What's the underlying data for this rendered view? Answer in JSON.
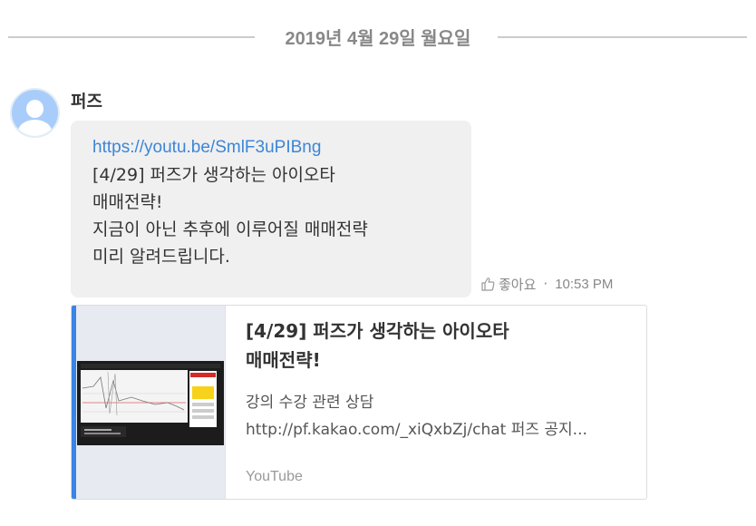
{
  "date_divider": {
    "text": "2019년 4월 29일 월요일"
  },
  "message": {
    "sender": "퍼즈",
    "link": "https://youtu.be/SmlF3uPIBng",
    "lines": [
      "[4/29] 퍼즈가 생각하는 아이오타",
      "매매전략!",
      "지금이 아닌 추후에 이루어질 매매전략",
      "미리 알려드립니다."
    ],
    "like_label": "좋아요",
    "separator": "·",
    "time": "10:53 PM"
  },
  "link_card": {
    "title_lines": [
      "[4/29] 퍼즈가 생각하는 아이오타",
      "매매전략!"
    ],
    "desc_lines": [
      "강의 수강 관련 상담",
      "http://pf.kakao.com/_xiQxbZj/chat 퍼즈 공지..."
    ],
    "source": "YouTube",
    "accent_color": "#3a84e6",
    "thumbnail_icon": "video-thumbnail"
  },
  "colors": {
    "link": "#3b86d8",
    "bubble_bg": "#f0f0f0",
    "avatar": "#a9cdfb"
  }
}
